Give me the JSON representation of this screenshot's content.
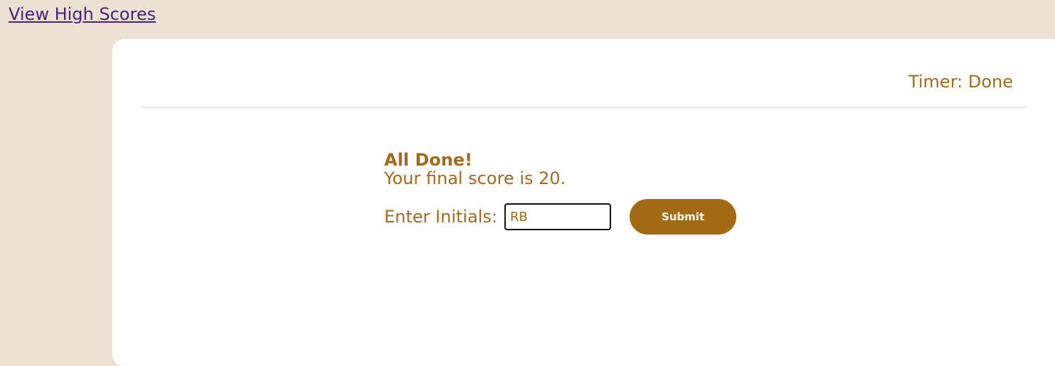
{
  "header": {
    "high_scores_link": "View High Scores"
  },
  "quiz": {
    "timer_text": "Timer: Done",
    "title": "All Done!",
    "final_score_text": "Your final score is 20.",
    "initials_label": "Enter Initials:",
    "initials_value": "RB",
    "submit_label": "Submit"
  },
  "colors": {
    "background": "#ebe2d4",
    "card": "#ffffff",
    "accent_text": "#a06a1f",
    "button_bg": "#a46a13",
    "link": "#4b1f7a"
  }
}
